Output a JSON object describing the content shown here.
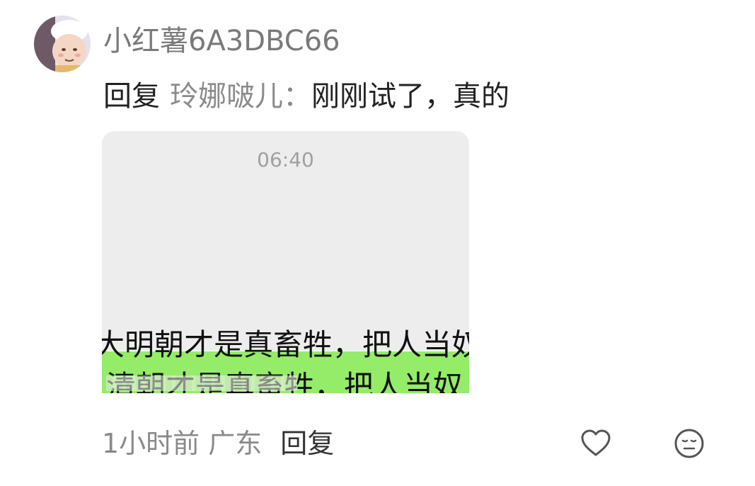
{
  "comment": {
    "username": "小红薯6A3DBC66",
    "reply_prefix": "回复",
    "mention": "玲娜啵儿",
    "colon": "：",
    "text": "刚刚试了，真的"
  },
  "screenshot": {
    "time": "06:40",
    "green_bubble_text": "清朝才是真畜牲，把人当奴",
    "second_text": "大明朝才是真畜牲，把人当奴"
  },
  "meta": {
    "time_ago": "1小时前",
    "location": "广东",
    "reply_label": "回复"
  },
  "icons": {
    "like": "heart-outline-icon",
    "emoji": "emoji-face-icon"
  },
  "colors": {
    "green_bubble": "#95ec69",
    "screenshot_bg": "#ededed",
    "username": "#7a7a7a"
  }
}
